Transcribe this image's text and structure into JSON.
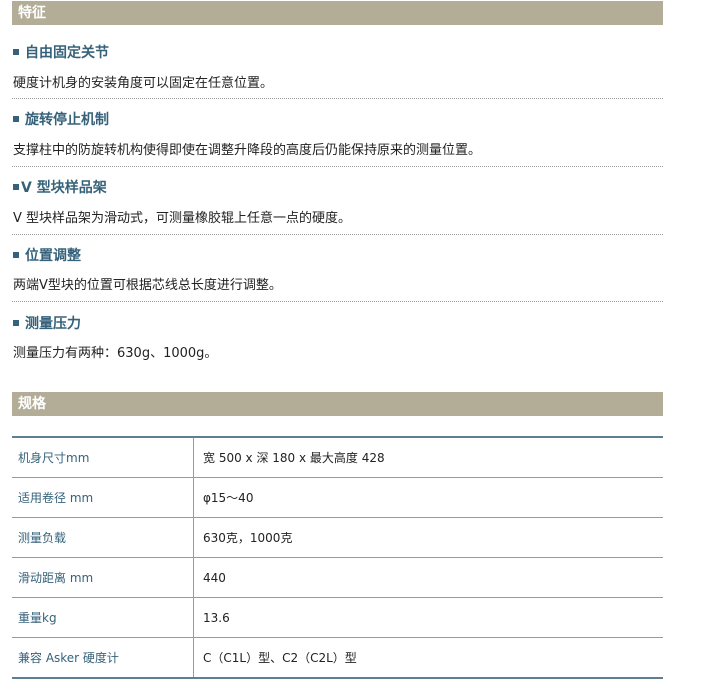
{
  "features": {
    "heading": "特征",
    "items": [
      {
        "title": "自由固定关节",
        "desc": "硬度计机身的安装角度可以固定在任意位置。"
      },
      {
        "title": "旋转停止机制",
        "desc": "支撑柱中的防旋转机构使得即使在调整升降段的高度后仍能保持原来的测量位置。"
      },
      {
        "title": "V 型块样品架",
        "desc": "V 型块样品架为滑动式，可测量橡胶辊上任意一点的硬度。"
      },
      {
        "title": "位置调整",
        "desc": "两端V型块的位置可根据芯线总长度进行调整。"
      },
      {
        "title": "测量压力",
        "desc": "测量压力有两种：630g、1000g。"
      }
    ]
  },
  "specs": {
    "heading": "规格",
    "rows": [
      {
        "label": "机身尺寸mm",
        "value": "宽 500 x 深 180 x 最大高度 428"
      },
      {
        "label": "适用卷径 mm",
        "value": "φ15～40"
      },
      {
        "label": "测量负载",
        "value": "630克，1000克"
      },
      {
        "label": "滑动距离 mm",
        "value": "440"
      },
      {
        "label": "重量kg",
        "value": "13.6"
      },
      {
        "label": "兼容 Asker 硬度计",
        "value": "C（C1L）型、C2（C2L）型"
      }
    ]
  }
}
